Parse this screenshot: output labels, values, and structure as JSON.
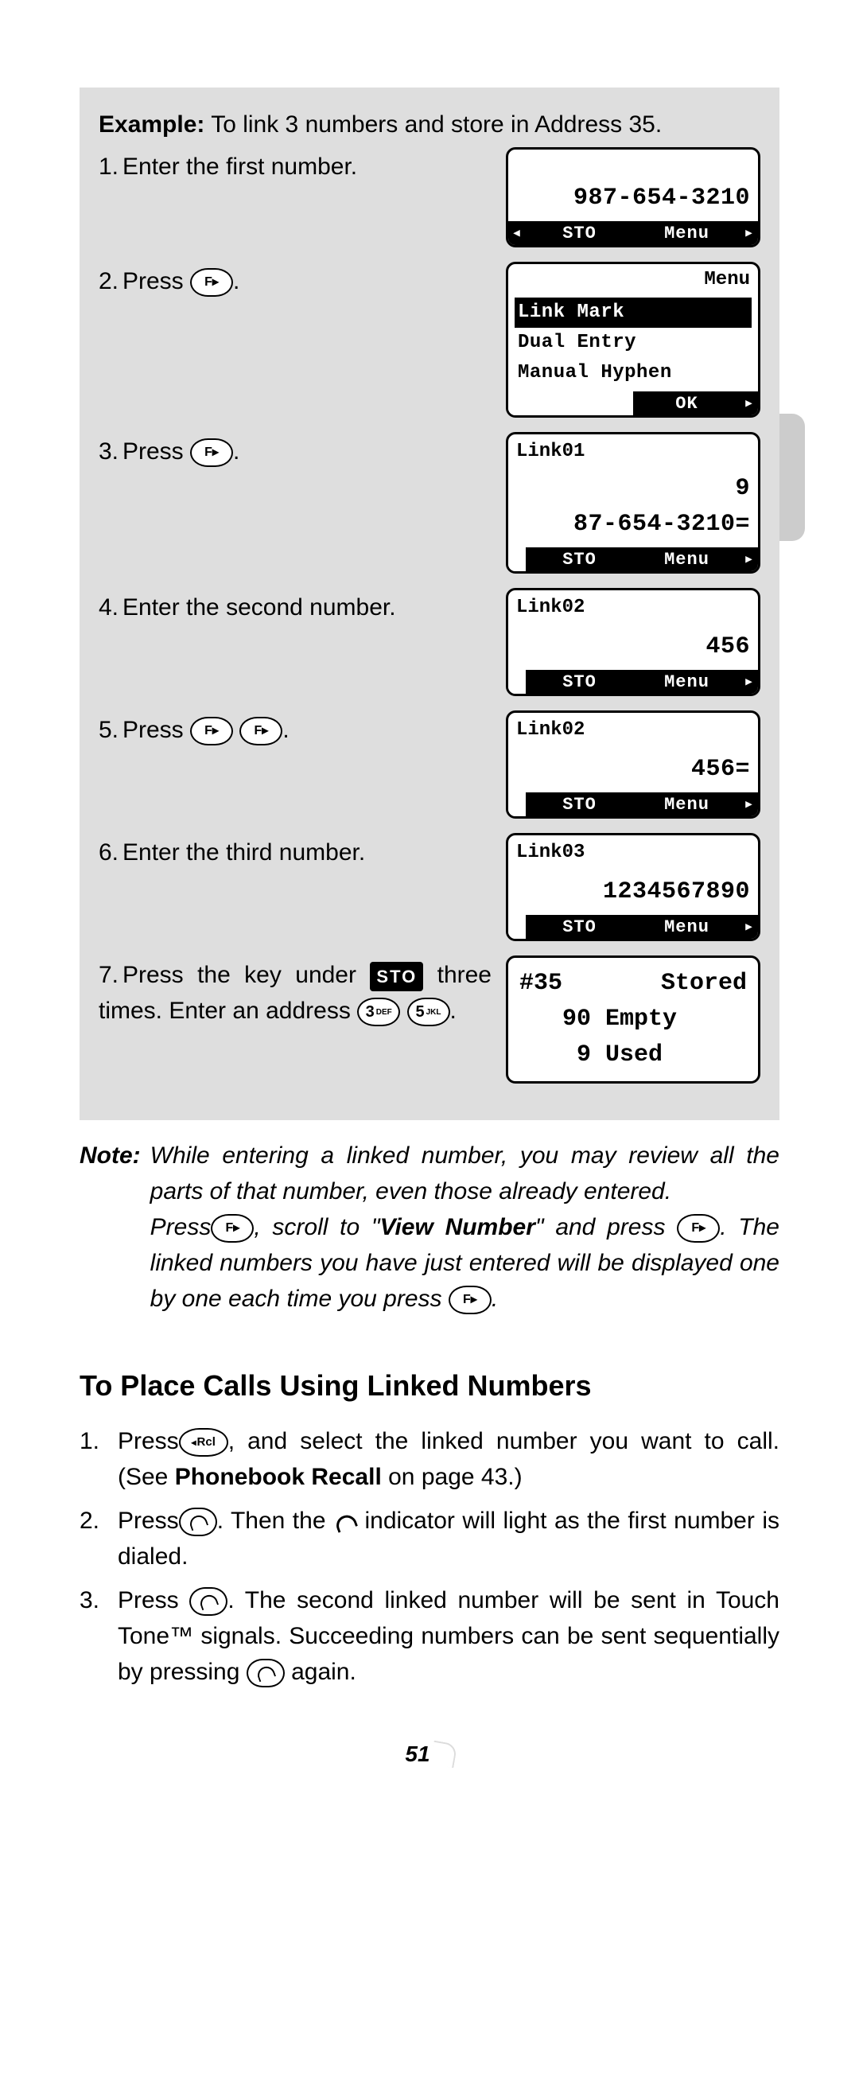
{
  "page_number": "51",
  "example": {
    "heading_label": "Example:",
    "heading_text": "To link 3 numbers and store in Address 35.",
    "steps": [
      {
        "n": "1.",
        "text": "Enter the first number."
      },
      {
        "n": "2.",
        "text": "Press "
      },
      {
        "n": "3.",
        "text": "Press "
      },
      {
        "n": "4.",
        "text": "Enter the second number."
      },
      {
        "n": "5.",
        "text": "Press "
      },
      {
        "n": "6.",
        "text": "Enter the third number."
      },
      {
        "n7": "7.",
        "text7a": "Press the key under ",
        "sto": "STO",
        "text7b": " three times. Enter an ad­dress "
      }
    ],
    "key3": {
      "n": "3",
      "l": "DEF"
    },
    "key5": {
      "n": "5",
      "l": "JKL"
    }
  },
  "screens": {
    "s1": {
      "num": "987-654-3210",
      "left": "STO",
      "right": "Menu"
    },
    "s2": {
      "top": "Menu",
      "items": [
        "Link Mark",
        "Dual Entry",
        "Manual Hyphen"
      ],
      "ok": "OK"
    },
    "s3": {
      "top": "Link01",
      "line1": "9",
      "line2": "87-654-3210=",
      "left": "STO",
      "right": "Menu"
    },
    "s4": {
      "top": "Link02",
      "line": "456",
      "left": "STO",
      "right": "Menu"
    },
    "s5": {
      "top": "Link02",
      "line": "456=",
      "left": "STO",
      "right": "Menu"
    },
    "s6": {
      "top": "Link03",
      "line": "1234567890",
      "left": "STO",
      "right": "Menu"
    },
    "s7": {
      "l1a": "#35",
      "l1b": "Stored",
      "l2a": "90",
      "l2b": "Empty",
      "l3a": "9",
      "l3b": "Used"
    }
  },
  "note": {
    "label": "Note:",
    "p1": "While entering a linked number, you may review all the parts of that number, even those already entered.",
    "p2a": "Press",
    "p2b": ", scroll to \"",
    "viewnum": "View Number",
    "p2c": "\" and press ",
    "p2d": ". The linked numbers you have just entered will be displayed one by one each time you press ",
    "p2e": "."
  },
  "section_title": "To Place Calls Using Linked Numbers",
  "place": {
    "s1a": "Press",
    "rcl": "Rcl",
    "s1b": ", and select the linked number you want to call. (See ",
    "pbrecall": "Phonebook Recall",
    "s1c": " on page 43.)",
    "s2a": "Press",
    "s2b": ". Then the ",
    "s2c": " indicator will light as the first number is dialed.",
    "s3a": "Press ",
    "s3b": ". The second linked number will be sent in Touch Tone™ signals. Succeeding numbers can be sent sequentially by pressing ",
    "s3c": " again."
  }
}
